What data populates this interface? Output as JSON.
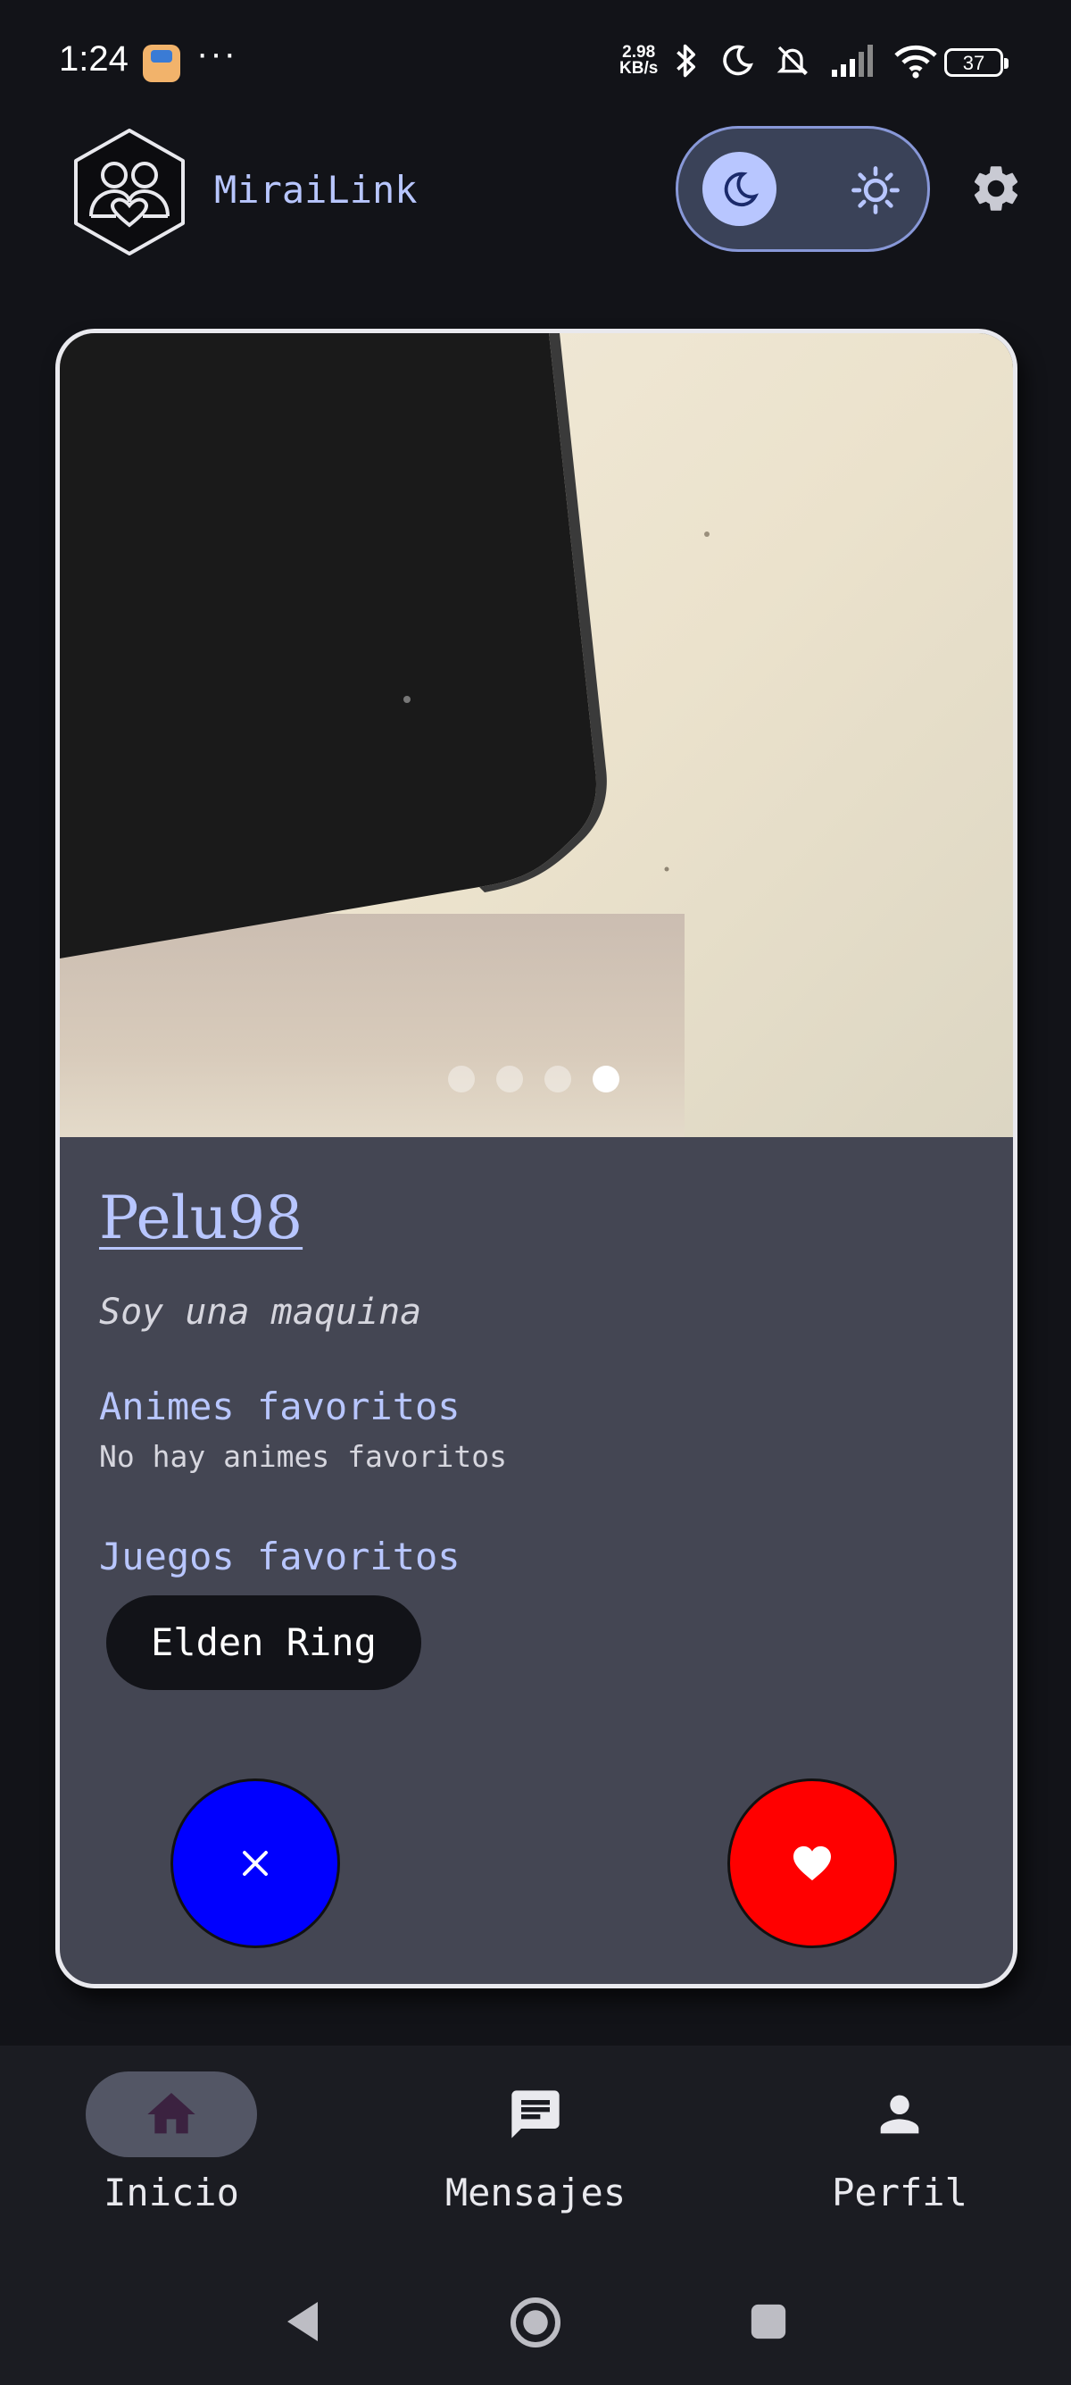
{
  "status_bar": {
    "time": "1:24",
    "overflow": "···",
    "net_speed_value": "2.98",
    "net_speed_unit": "KB/s",
    "battery": "37",
    "icons": [
      "bluetooth-icon",
      "moon-icon",
      "mute-icon",
      "signal-icon",
      "wifi-icon",
      "battery-icon"
    ]
  },
  "header": {
    "app_name": "MiraiLink",
    "theme_mode": "dark"
  },
  "profile": {
    "photo_count": 4,
    "active_photo_index": 4,
    "username": "Pelu98",
    "bio": "Soy una maquina",
    "animes_title": "Animes favoritos",
    "animes_empty": "No hay animes favoritos",
    "games_title": "Juegos favoritos",
    "games": [
      "Elden Ring"
    ]
  },
  "actions": {
    "dislike_color": "#0000ff",
    "like_color": "#ff0000"
  },
  "nav": {
    "items": [
      {
        "label": "Inicio",
        "icon": "home-icon",
        "active": true
      },
      {
        "label": "Mensajes",
        "icon": "chat-icon",
        "active": false
      },
      {
        "label": "Perfil",
        "icon": "person-icon",
        "active": false
      }
    ]
  },
  "colors": {
    "accent": "#b8c6ff",
    "background": "#121318",
    "card": "#444653"
  }
}
